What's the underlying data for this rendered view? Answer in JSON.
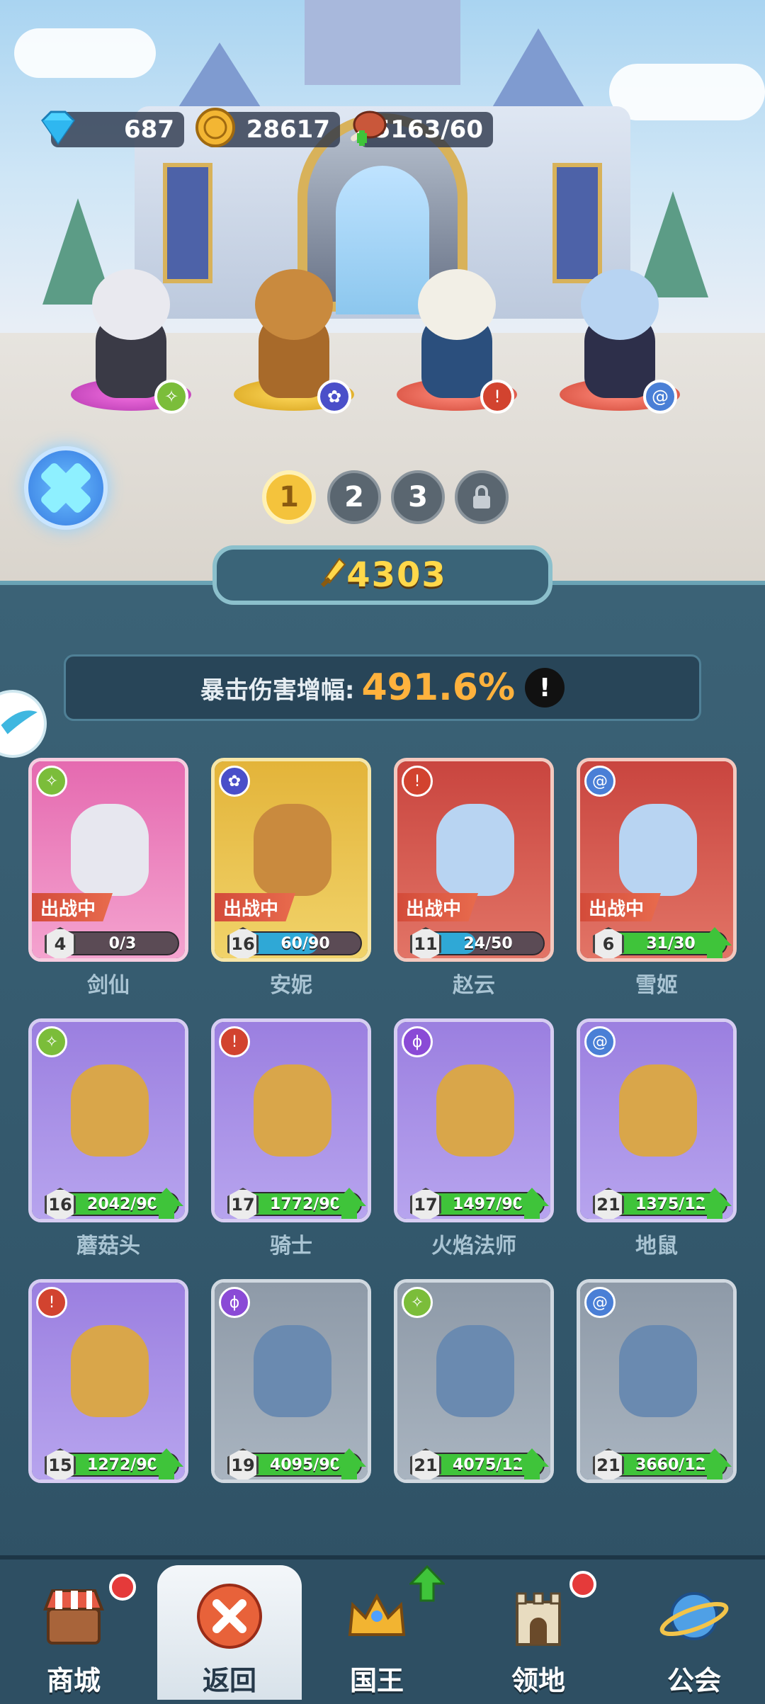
{
  "resources": {
    "gems": "687",
    "coins": "28617",
    "stamina": "5163/60"
  },
  "stage_heroes": [
    {
      "name": "剑仙",
      "element": "wind-icon"
    },
    {
      "name": "安妮",
      "element": "paw-icon"
    },
    {
      "name": "赵云",
      "element": "sword-icon"
    },
    {
      "name": "雪姬",
      "element": "spiral-icon"
    }
  ],
  "team_tabs": [
    "1",
    "2",
    "3"
  ],
  "power": "4303",
  "crit": {
    "label": "暴击伤害增幅:",
    "value": "491.6%",
    "info": "!"
  },
  "deploy_label": "出战中",
  "cards": [
    {
      "name": "剑仙",
      "level": "4",
      "progress": "0/3",
      "fill": 0.0,
      "deployed": true,
      "upgrade": false,
      "element": "wind-icon",
      "theme": "pink"
    },
    {
      "name": "安妮",
      "level": "16",
      "progress": "60/90",
      "fill": 0.67,
      "deployed": true,
      "upgrade": false,
      "element": "paw-icon",
      "theme": "gold"
    },
    {
      "name": "赵云",
      "level": "11",
      "progress": "24/50",
      "fill": 0.48,
      "deployed": true,
      "upgrade": false,
      "element": "sword-icon",
      "theme": "red"
    },
    {
      "name": "雪姬",
      "level": "6",
      "progress": "31/30",
      "fill": 1.0,
      "deployed": true,
      "upgrade": true,
      "element": "spiral-icon",
      "theme": "red"
    },
    {
      "name": "蘑菇头",
      "level": "16",
      "progress": "2042/90",
      "fill": 1.0,
      "deployed": false,
      "upgrade": true,
      "element": "wind-icon",
      "theme": "purple"
    },
    {
      "name": "骑士",
      "level": "17",
      "progress": "1772/90",
      "fill": 1.0,
      "deployed": false,
      "upgrade": true,
      "element": "sword-icon",
      "theme": "purple"
    },
    {
      "name": "火焰法师",
      "level": "17",
      "progress": "1497/90",
      "fill": 1.0,
      "deployed": false,
      "upgrade": true,
      "element": "wand-icon",
      "theme": "purple"
    },
    {
      "name": "地鼠",
      "level": "21",
      "progress": "1375/12",
      "fill": 1.0,
      "deployed": false,
      "upgrade": true,
      "element": "spiral-icon",
      "theme": "purple"
    },
    {
      "name": "",
      "level": "15",
      "progress": "1272/90",
      "fill": 1.0,
      "deployed": false,
      "upgrade": true,
      "element": "sword-icon",
      "theme": "purple"
    },
    {
      "name": "",
      "level": "19",
      "progress": "4095/90",
      "fill": 1.0,
      "deployed": false,
      "upgrade": true,
      "element": "wand-icon",
      "theme": "gray"
    },
    {
      "name": "",
      "level": "21",
      "progress": "4075/12",
      "fill": 1.0,
      "deployed": false,
      "upgrade": true,
      "element": "wind-icon",
      "theme": "gray"
    },
    {
      "name": "",
      "level": "21",
      "progress": "3660/12",
      "fill": 1.0,
      "deployed": false,
      "upgrade": true,
      "element": "spiral-icon",
      "theme": "gray"
    }
  ],
  "nav": {
    "shop": "商城",
    "back": "返回",
    "king": "国王",
    "territory": "领地",
    "guild": "公会"
  },
  "colors": {
    "accent": "#ffb23d",
    "power": "#ffd84a",
    "upgrade": "#3fc43a",
    "reddot": "#e53a3a"
  }
}
